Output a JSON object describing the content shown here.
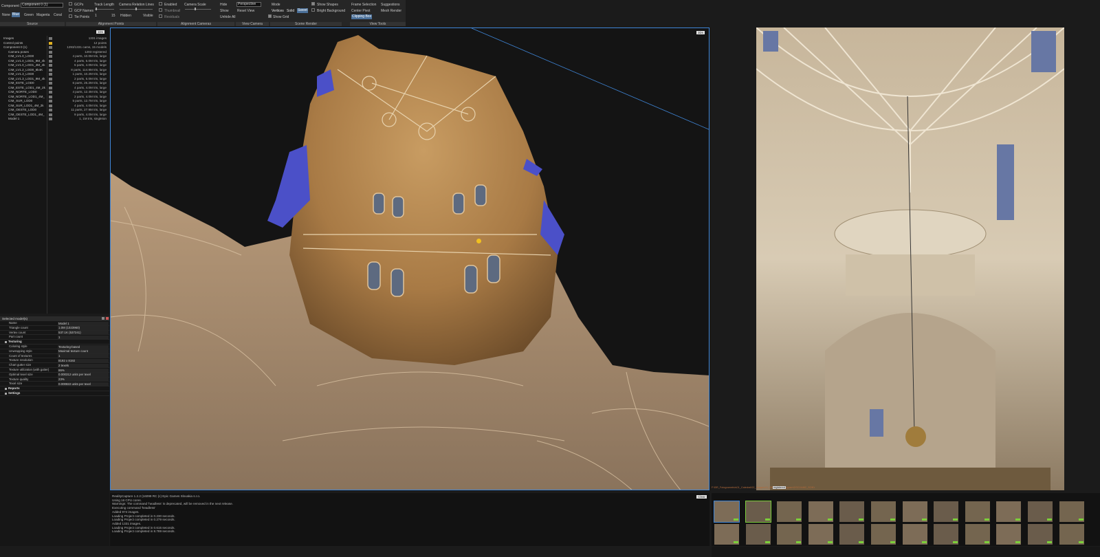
{
  "ribbon": {
    "source": {
      "title": "Source",
      "component_label": "Component",
      "component_value": "Component 0 (1)",
      "colors": [
        "None",
        "Blue",
        "Green",
        "Magenta",
        "Coral"
      ],
      "selected_color": "Blue"
    },
    "alignment_points": {
      "title": "Alignment Points",
      "gcps": "GCPs",
      "gcp_names": "GCP Names",
      "tie_points": "Tie Points",
      "track_length": "Track Length",
      "track_min": "1",
      "track_max": "15",
      "camera_relation_lines": "Camera Relation Lines",
      "hidden": "Hidden",
      "visible": "Visible"
    },
    "alignment_cameras": {
      "title": "Alignment Cameras",
      "enabled": "Enabled",
      "thumbnail": "Thumbnail",
      "residuals": "Residuals",
      "camera_scale": "Camera Scale"
    },
    "view_camera": {
      "title": "View Camera",
      "hide": "Hide",
      "show": "Show",
      "unhide_all": "Unhide All"
    },
    "scene_render": {
      "title": "Scene Render",
      "projection": "Perspective",
      "reset_view": "Reset View",
      "mode": "Mode",
      "modes": [
        "Vertices",
        "Solid",
        "Sweet"
      ],
      "selected_mode": "Sweet",
      "show_shapes": "Show Shapes",
      "bright_background": "Bright Background",
      "show_grid": "Show Grid"
    },
    "view_tools": {
      "title": "View Tools",
      "frame_selection": "Frame Selection",
      "suggestions": "Suggestions",
      "center_pivot": "Center Pivot",
      "mesh_render": "Mesh Render",
      "clipping_box": "Clipping Box"
    }
  },
  "tree": {
    "menu_label": "1Ds",
    "rows": [
      {
        "name": "Images",
        "value": "1331 images",
        "indent": 0
      },
      {
        "name": "Control points",
        "value": "12 points",
        "indent": 0
      },
      {
        "name": "Component 0 (1)",
        "value": "1293/1331 cams, 15 models",
        "indent": 0
      },
      {
        "name": "Camera poses",
        "value": "1293 registered",
        "indent": 1
      },
      {
        "name": "CIM_LV1.0_LOD0",
        "value": "4 parts, 10.0M tris, large",
        "indent": 1
      },
      {
        "name": "CIM_LV1.0_LOD1_9M_4k",
        "value": "4 parts, 5.0M tris, large",
        "indent": 1
      },
      {
        "name": "CIM_LV1.0_LOD1_4M_4k",
        "value": "5 parts, 4.0M tris, large",
        "indent": 1
      },
      {
        "name": "CIM_LV1.2_LOD0_6k4K",
        "value": "8 parts, 114.8M tris, large",
        "indent": 1
      },
      {
        "name": "CIM_LV1.3_LOD0",
        "value": "1 parts, 10.2M tris, large",
        "indent": 1
      },
      {
        "name": "CIM_LV1.3_LOD1_9M_4k",
        "value": "2 parts, 5.0M tris, large",
        "indent": 1
      },
      {
        "name": "CIM_ESTE_LOD0",
        "value": "6 parts, 25.2M tris, large",
        "indent": 1
      },
      {
        "name": "CIM_ESTE_LOD1_4M_2k",
        "value": "4 parts, 4.0M tris, large",
        "indent": 1
      },
      {
        "name": "CIM_NORTE_LOD0",
        "value": "4 parts, 12.4M tris, large",
        "indent": 1
      },
      {
        "name": "CIM_NORTE_LOD1_4M_",
        "value": "2 parts, 4.0M tris, large",
        "indent": 1
      },
      {
        "name": "CIM_SUR_LOD0",
        "value": "5 parts, 12.7M tris, large",
        "indent": 1
      },
      {
        "name": "CIM_SUR_LOD1_4M_2k",
        "value": "4 parts, 4.0M tris, large",
        "indent": 1
      },
      {
        "name": "CIM_OESTE_LOD0",
        "value": "11 parts, 27.9M tris, large",
        "indent": 1
      },
      {
        "name": "CIM_OESTE_LOD1_4M_",
        "value": "9 parts, 4.0M tris, large",
        "indent": 1
      },
      {
        "name": "Model 1",
        "value": "1, 1M tris, singleton",
        "indent": 1
      }
    ]
  },
  "props": {
    "title": "Selected model(s)",
    "rows": [
      {
        "key": "Name",
        "value": "Model 1",
        "header": false
      },
      {
        "key": "Triangle count",
        "value": "1.0M (1023960)",
        "header": false
      },
      {
        "key": "Vertex count",
        "value": "537.1K (537241)",
        "header": false
      },
      {
        "key": "Part count",
        "value": "1",
        "header": false
      },
      {
        "key": "Texturing",
        "value": "",
        "header": true
      },
      {
        "key": "Coloring style",
        "value": "Texturing-based",
        "header": false
      },
      {
        "key": "Unwrapping style",
        "value": "Maximal texture count",
        "header": false
      },
      {
        "key": "Count of textures",
        "value": "1",
        "header": false
      },
      {
        "key": "Texture resolution",
        "value": "8192 x 8192",
        "header": false
      },
      {
        "key": "Chart gutter size",
        "value": "2 texels",
        "header": false
      },
      {
        "key": "Texture utilization (with gutter)",
        "value": "86%",
        "header": false
      },
      {
        "key": "Optimal texel size",
        "value": "0.000312 units per texel",
        "header": false
      },
      {
        "key": "Texture quality",
        "value": "23%",
        "header": false
      },
      {
        "key": "Texel size",
        "value": "0.000822 units per texel",
        "header": false
      },
      {
        "key": "Reports",
        "value": "",
        "header": true
      },
      {
        "key": "Settings",
        "value": "",
        "header": true
      }
    ]
  },
  "viewport": {
    "badge": "3Ds"
  },
  "photo": {
    "path": "F:\\BR_Fotogrametria\\01_Catedral\\02_Images\\01_BRGSolid\\Fotogram\\DSC04462_SONY_DSC-7M2Q-...",
    "tag": "registered"
  },
  "log": {
    "badge": "Clear",
    "lines": [
      "RealityCapture 1.2.2 (16099 RC (c) Epic Games Slovakia s.r.o.",
      "Using 16 CPU cores.",
      "Warnings: The command 'headless' is deprecated, will be removed in the next release.",
      "Executing command 'headless'",
      "Added 974 images.",
      "Loading Project completed in 0.230 seconds.",
      "Loading Project completed in 0.279 seconds.",
      "Added 1331 images.",
      "Loading Project completed in 0.615 seconds.",
      "Loading Project completed in 8.789 seconds."
    ]
  },
  "colors": {
    "accent": "#3f86d8",
    "selected": "#4a6f98",
    "badge_green": "#7ccf3a",
    "warning": "#e0b020"
  }
}
